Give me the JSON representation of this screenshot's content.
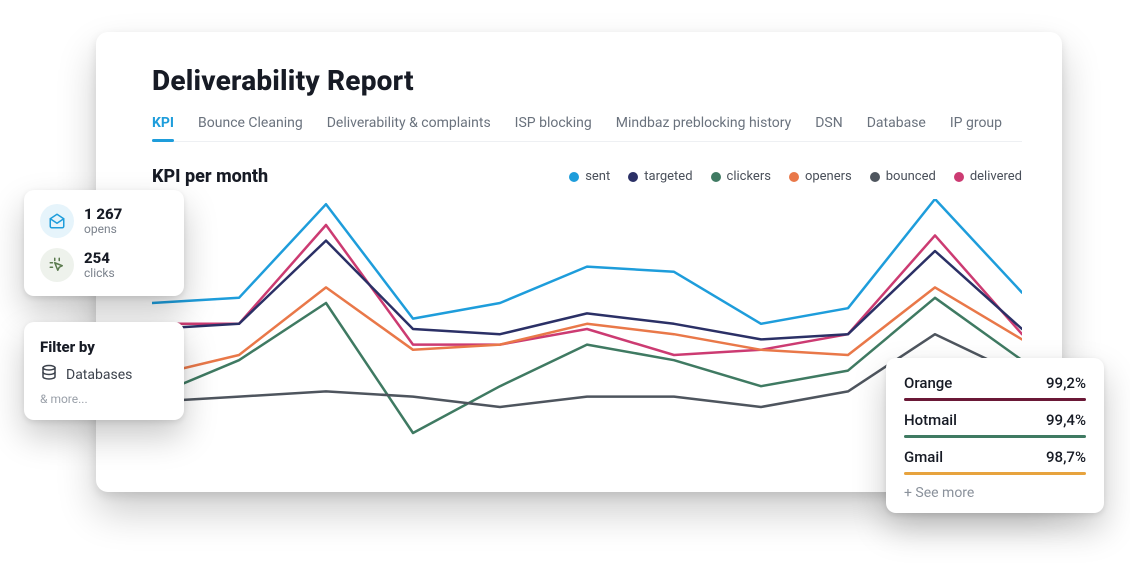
{
  "title": "Deliverability Report",
  "tabs": [
    {
      "label": "KPI",
      "active": true
    },
    {
      "label": "Bounce Cleaning"
    },
    {
      "label": "Deliverability & complaints"
    },
    {
      "label": "ISP blocking"
    },
    {
      "label": "Mindbaz preblocking history"
    },
    {
      "label": "DSN"
    },
    {
      "label": "Database"
    },
    {
      "label": "IP group"
    }
  ],
  "chart_title": "KPI per month",
  "legend": [
    {
      "name": "sent",
      "color": "#1e9ddb"
    },
    {
      "name": "targeted",
      "color": "#2b3066"
    },
    {
      "name": "clickers",
      "color": "#3f7a62"
    },
    {
      "name": "openers",
      "color": "#e97849"
    },
    {
      "name": "bounced",
      "color": "#4e555e"
    },
    {
      "name": "delivered",
      "color": "#cc3b72"
    }
  ],
  "chart_data": {
    "type": "line",
    "title": "KPI per month",
    "xlabel": "",
    "ylabel": "",
    "ylim": [
      0,
      100
    ],
    "x": [
      1,
      2,
      3,
      4,
      5,
      6,
      7,
      8,
      9,
      10
    ],
    "series": [
      {
        "name": "sent",
        "color": "#1e9ddb",
        "values": [
          60,
          62,
          98,
          54,
          60,
          74,
          72,
          52,
          58,
          100,
          64
        ]
      },
      {
        "name": "delivered",
        "color": "#cc3b72",
        "values": [
          52,
          52,
          90,
          44,
          44,
          50,
          40,
          42,
          48,
          86,
          48
        ]
      },
      {
        "name": "targeted",
        "color": "#2b3066",
        "values": [
          50,
          52,
          84,
          50,
          48,
          56,
          52,
          46,
          48,
          80,
          50
        ]
      },
      {
        "name": "openers",
        "color": "#e97849",
        "values": [
          32,
          40,
          66,
          42,
          44,
          52,
          48,
          42,
          40,
          66,
          46
        ]
      },
      {
        "name": "clickers",
        "color": "#3f7a62",
        "values": [
          24,
          38,
          60,
          10,
          28,
          44,
          38,
          28,
          34,
          62,
          38
        ]
      },
      {
        "name": "bounced",
        "color": "#4e555e",
        "values": [
          22,
          24,
          26,
          24,
          20,
          24,
          24,
          20,
          26,
          48,
          32
        ]
      }
    ]
  },
  "stats": {
    "opens": {
      "value": "1 267",
      "label": "opens"
    },
    "clicks": {
      "value": "254",
      "label": "clicks"
    }
  },
  "filter": {
    "title": "Filter by",
    "item": "Databases",
    "more": "& more..."
  },
  "isp": {
    "rows": [
      {
        "name": "Orange",
        "value": "99,2%",
        "color": "#6a1836"
      },
      {
        "name": "Hotmail",
        "value": "99,4%",
        "color": "#3f7a62"
      },
      {
        "name": "Gmail",
        "value": "98,7%",
        "color": "#e7a33e"
      }
    ],
    "more": "+ See more"
  }
}
